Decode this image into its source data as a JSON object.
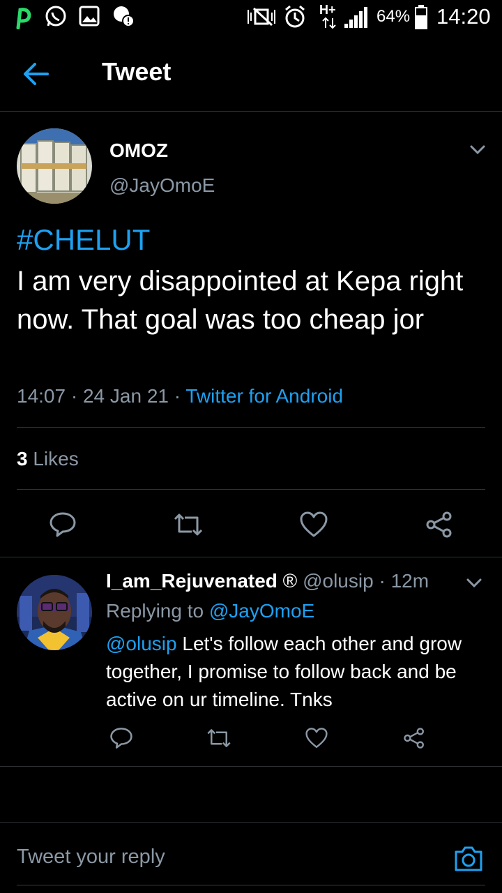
{
  "status_bar": {
    "time": "14:20",
    "battery_percent": "64%",
    "network": "H+",
    "icons": [
      "pinterest-icon",
      "whatsapp-icon",
      "gallery-icon",
      "notification-icon",
      "mute-icon",
      "alarm-icon",
      "data-arrows-icon",
      "signal-icon",
      "battery-icon"
    ]
  },
  "header": {
    "title": "Tweet"
  },
  "main_tweet": {
    "display_name": "OMOZ",
    "handle": "@JayOmoE",
    "hashtag": "#CHELUT",
    "text": "I am very disappointed at Kepa right now. That goal was too cheap jor",
    "time": "14:07",
    "date": "24 Jan 21",
    "separator": "·",
    "source": "Twitter for Android",
    "likes_count": "3",
    "likes_label": "Likes"
  },
  "reply": {
    "display_name": "I_am_Rejuvenated",
    "registered_mark": "®",
    "handle": "@olusip",
    "time_ago": "12m",
    "replying_prefix": "Replying to",
    "replying_to": "@JayOmoE",
    "mention": "@olusip",
    "text": "Let's follow each other and grow together, I promise to follow back and be active on ur timeline. Tnks"
  },
  "compose": {
    "placeholder": "Tweet your reply"
  },
  "colors": {
    "accent": "#1da1f2",
    "muted": "#8b98a5",
    "divider": "#2f3336",
    "background": "#000000"
  }
}
